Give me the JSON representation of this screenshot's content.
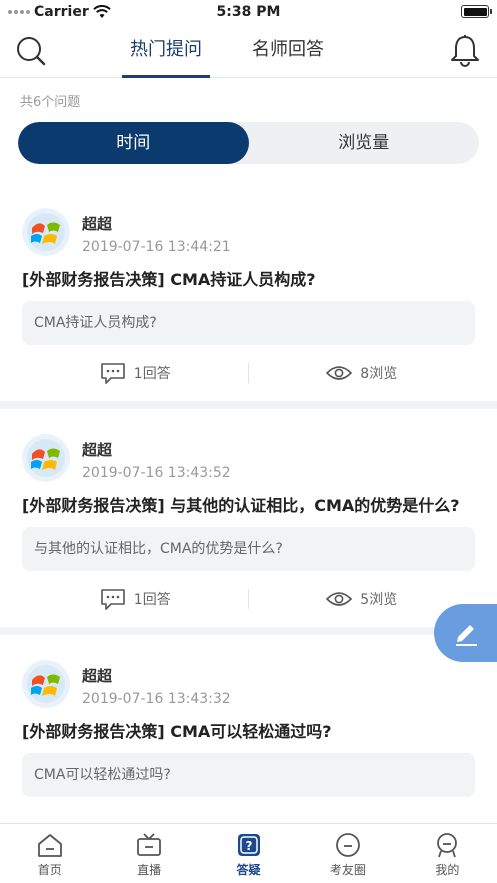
{
  "status_bar": {
    "carrier": "Carrier",
    "time": "5:38 PM"
  },
  "header": {
    "tabs": [
      {
        "label": "热门提问",
        "active": true
      },
      {
        "label": "名师回答",
        "active": false
      }
    ]
  },
  "count_text": "共6个问题",
  "sort": {
    "options": [
      "时间",
      "浏览量"
    ],
    "selected": "时间"
  },
  "questions": [
    {
      "username": "超超",
      "timestamp": "2019-07-16 13:44:21",
      "title": "[外部财务报告决策] CMA持证人员构成?",
      "body": "CMA持证人员构成?",
      "answers": "1回答",
      "views": "8浏览"
    },
    {
      "username": "超超",
      "timestamp": "2019-07-16 13:43:52",
      "title": "[外部财务报告决策] 与其他的认证相比，CMA的优势是什么?",
      "body": "与其他的认证相比，CMA的优势是什么?",
      "answers": "1回答",
      "views": "5浏览"
    },
    {
      "username": "超超",
      "timestamp": "2019-07-16 13:43:32",
      "title": "[外部财务报告决策] CMA可以轻松通过吗?",
      "body": "CMA可以轻松通过吗?",
      "answers": "",
      "views": ""
    }
  ],
  "bottom_nav": [
    {
      "label": "首页",
      "icon": "home-icon",
      "active": false
    },
    {
      "label": "直播",
      "icon": "tv-icon",
      "active": false
    },
    {
      "label": "答疑",
      "icon": "question-icon",
      "active": true
    },
    {
      "label": "考友圈",
      "icon": "circle-icon",
      "active": false
    },
    {
      "label": "我的",
      "icon": "profile-icon",
      "active": false
    }
  ],
  "colors": {
    "primary": "#0b3a6e",
    "accent": "#1d3e6e",
    "fab": "#6a9ce0"
  }
}
